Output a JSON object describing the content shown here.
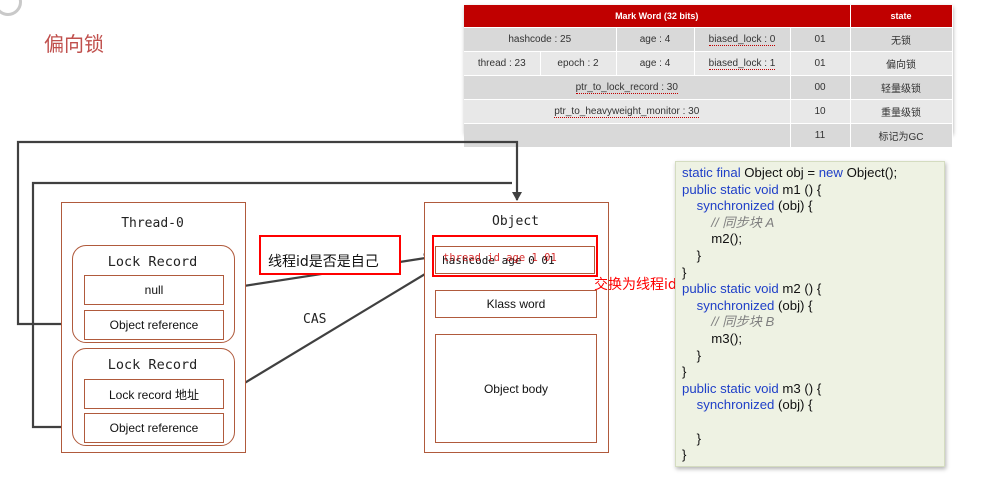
{
  "page": {
    "title": "偏向锁"
  },
  "mark_word_table": {
    "header": {
      "mark_word": "Mark Word (32 bits)",
      "state": "state"
    },
    "rows": [
      {
        "cells": [
          "hashcode : 25",
          "age : 4",
          "biased_lock : 0",
          "01"
        ],
        "state": "无锁"
      },
      {
        "cells": [
          "thread : 23",
          "epoch : 2",
          "age : 4",
          "biased_lock : 1",
          "01"
        ],
        "state": "偏向锁"
      },
      {
        "cells": [
          "ptr_to_lock_record : 30",
          "00"
        ],
        "state": "轻量级锁"
      },
      {
        "cells": [
          "ptr_to_heavyweight_monitor : 30",
          "10"
        ],
        "state": "重量级锁"
      },
      {
        "cells": [
          "",
          "11"
        ],
        "state": "标记为GC"
      }
    ]
  },
  "diagram": {
    "thread": {
      "title": "Thread-0",
      "lock_record_1": {
        "title": "Lock Record",
        "field_1": "null",
        "field_2": "Object reference"
      },
      "lock_record_2": {
        "title": "Lock Record",
        "field_1": "Lock record 地址",
        "field_2": "Object reference"
      }
    },
    "object": {
      "title": "Object",
      "mark_word": "hashcode age 0 01",
      "mark_word_overlay": "thread id age 1 01",
      "klass_word": "Klass word",
      "body": "Object body"
    },
    "labels": {
      "question": "线程id是否是自己",
      "cas": "CAS",
      "swap": "交换为线程id"
    },
    "colors": {
      "box_border": "#b05a3c",
      "highlight": "#ff0000",
      "arrow": "#404040"
    }
  },
  "code": {
    "lines": [
      [
        "static final Object obj = ",
        "new",
        " Object();"
      ],
      [
        "public static void",
        " m1 () {"
      ],
      [
        "    ",
        "synchronized",
        " (obj) {"
      ],
      [
        "        // 同步块 A"
      ],
      [
        "        m2();"
      ],
      [
        "    }"
      ],
      [
        "}"
      ],
      [
        "public static void",
        " m2 () {"
      ],
      [
        "    ",
        "synchronized",
        " (obj) {"
      ],
      [
        "        // 同步块 B"
      ],
      [
        "        m3();"
      ],
      [
        "    }"
      ],
      [
        "}"
      ],
      [
        "public static void",
        " m3 () {"
      ],
      [
        "    ",
        "synchronized",
        " (obj) {"
      ],
      [
        ""
      ],
      [
        "    }"
      ],
      [
        "}"
      ]
    ]
  }
}
